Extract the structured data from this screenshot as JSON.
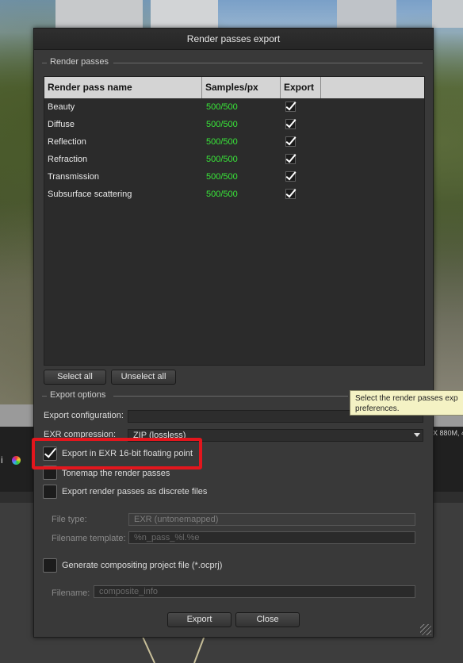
{
  "dialog": {
    "title": "Render passes export"
  },
  "render_passes": {
    "group_label": "Render passes",
    "columns": [
      "Render pass name",
      "Samples/px",
      "Export"
    ],
    "rows": [
      {
        "name": "Beauty",
        "samples": "500/500",
        "export": true
      },
      {
        "name": "Diffuse",
        "samples": "500/500",
        "export": true
      },
      {
        "name": "Reflection",
        "samples": "500/500",
        "export": true
      },
      {
        "name": "Refraction",
        "samples": "500/500",
        "export": true
      },
      {
        "name": "Transmission",
        "samples": "500/500",
        "export": true
      },
      {
        "name": "Subsurface scattering",
        "samples": "500/500",
        "export": true
      }
    ],
    "select_all_label": "Select all",
    "unselect_all_label": "Unselect all"
  },
  "export_options": {
    "group_label": "Export options",
    "config_label": "Export configuration:",
    "config_value": "",
    "compression_label": "EXR compression:",
    "compression_value": "ZIP (lossless)",
    "exr16_label": "Export in EXR 16-bit floating point",
    "exr16_checked": true,
    "tonemap_label": "Tonemap the render passes",
    "tonemap_checked": false,
    "discrete_label": "Export render passes as discrete files",
    "discrete_checked": false,
    "file_type_label": "File type:",
    "file_type_value": "EXR (untonemapped)",
    "filename_template_label": "Filename template:",
    "filename_template_value": "%n_pass_%l.%e",
    "compositing_label": "Generate compositing project file (*.ocprj)",
    "compositing_checked": false,
    "filename_label": "Filename:",
    "filename_value": "composite_info"
  },
  "tooltip": {
    "line1": "Select the render passes exp",
    "line2": "preferences."
  },
  "footer": {
    "export_label": "Export",
    "close_label": "Close"
  },
  "background": {
    "status_text": "X 880M, 4"
  },
  "colors": {
    "samples_text": "#39e639",
    "highlight": "#e3161d"
  }
}
